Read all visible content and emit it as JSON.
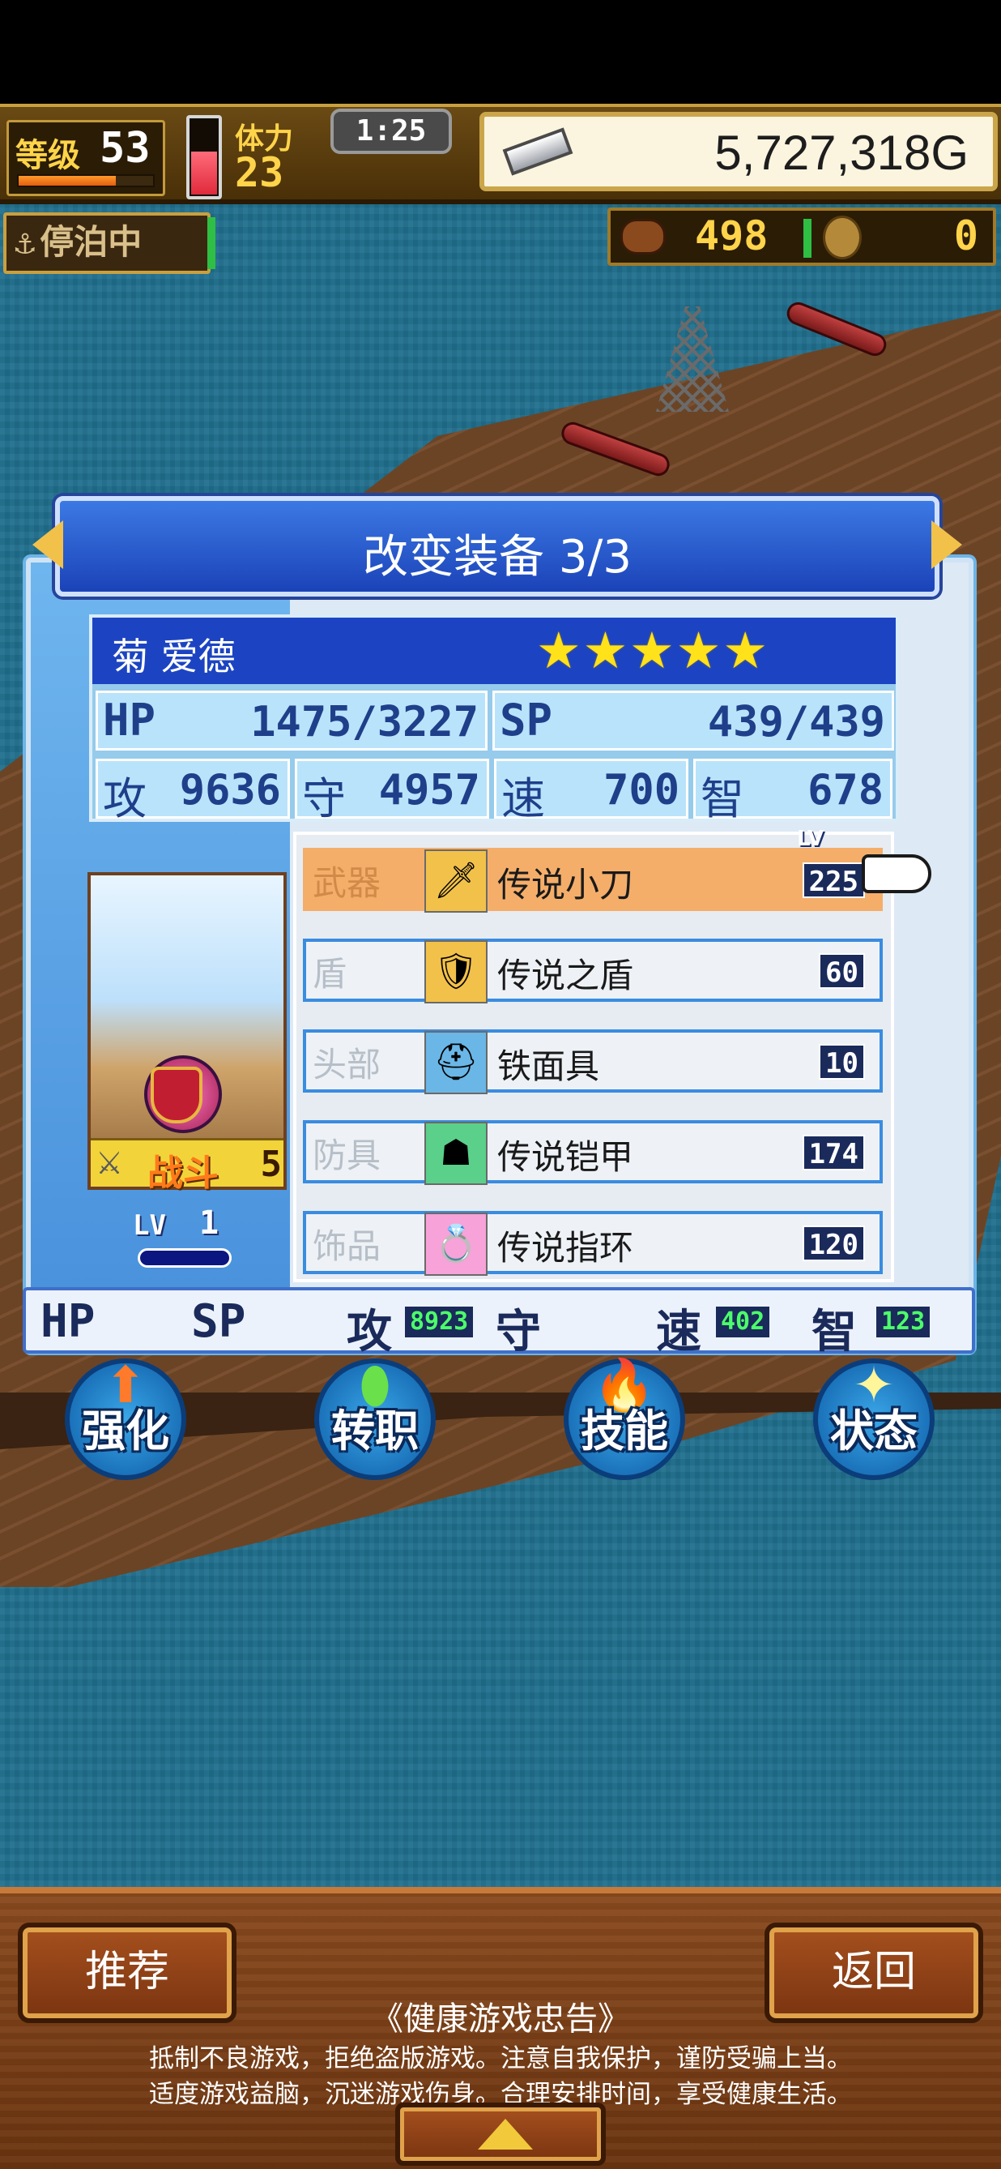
{
  "hud": {
    "level_label": "等级",
    "level": "53",
    "exp_progress": 0.72,
    "stamina_label": "体力",
    "stamina": "23",
    "stamina_fill": 0.55,
    "timer": "1:25",
    "gold": "5,727,318G",
    "docked_label": "停泊中",
    "food": "498",
    "coins": "0"
  },
  "dialog": {
    "title": "改变装备 3/3",
    "character": {
      "name": "菊 爱德",
      "stars": "★★★★★",
      "hp_label": "HP",
      "hp": "1475/3227",
      "sp_label": "SP",
      "sp": "439/439",
      "atk_label": "攻",
      "atk": "9636",
      "def_label": "守",
      "def": "4957",
      "spd_label": "速",
      "spd": "700",
      "int_label": "智",
      "int": "678",
      "job": "战斗",
      "job_level": "5",
      "lv_label": "LV",
      "lv": "1"
    },
    "equipment_lv_tag": "LV",
    "equipment": [
      {
        "slot": "武器",
        "name": "传说小刀",
        "level": "225",
        "icon": "dagger-icon",
        "selected": true
      },
      {
        "slot": "盾",
        "name": "传说之盾",
        "level": "60",
        "icon": "shield-icon",
        "selected": false
      },
      {
        "slot": "头部",
        "name": "铁面具",
        "level": "10",
        "icon": "helmet-icon",
        "selected": false
      },
      {
        "slot": "防具",
        "name": "传说铠甲",
        "level": "174",
        "icon": "armor-icon",
        "selected": false
      },
      {
        "slot": "饰品",
        "name": "传说指环",
        "level": "120",
        "icon": "ring-icon",
        "selected": false
      }
    ],
    "diff": {
      "hp_label": "HP",
      "sp_label": "SP",
      "atk_label": "攻",
      "atk": "8923",
      "def_label": "守",
      "spd_label": "速",
      "spd": "402",
      "int_label": "智",
      "int": "123"
    }
  },
  "actions": [
    {
      "label": "强化",
      "icon": "arrow-up-icon"
    },
    {
      "label": "转职",
      "icon": "potion-icon"
    },
    {
      "label": "技能",
      "icon": "flame-icon"
    },
    {
      "label": "状态",
      "icon": "sparkle-icon"
    }
  ],
  "footer": {
    "recommend_label": "推荐",
    "back_label": "返回",
    "notice_title": "《健康游戏忠告》",
    "notice_line_1": "抵制不良游戏，拒绝盗版游戏。注意自我保护，谨防受骗上当。",
    "notice_line_2": "适度游戏益脑，沉迷游戏伤身。合理安排时间，享受健康生活。"
  },
  "colors": {
    "sea": "#1f6e8c",
    "dialog_banner": "#1b43b8",
    "selected_row": "#f4ae6a",
    "star": "#ffe21a",
    "footer_wood": "#7a3410"
  }
}
